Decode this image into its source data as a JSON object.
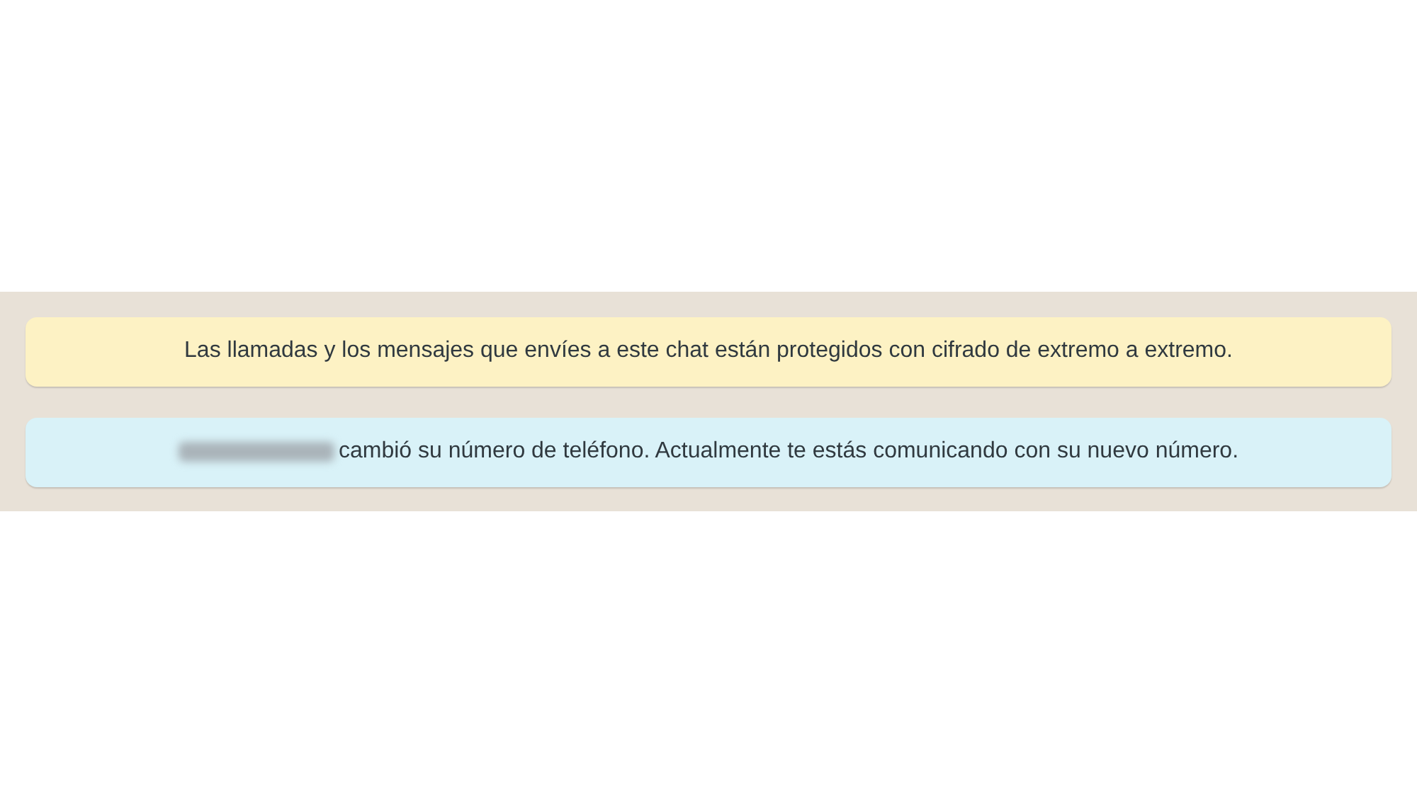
{
  "messages": [
    {
      "kind": "encryption",
      "text": "Las llamadas y los mensajes que envíes a este chat están protegidos con cifrado de extremo a extremo.",
      "redacted_name": false
    },
    {
      "kind": "number_change",
      "text": "cambió su número de teléfono. Actualmente te estás comunicando con su nuevo número.",
      "redacted_name": true
    }
  ]
}
